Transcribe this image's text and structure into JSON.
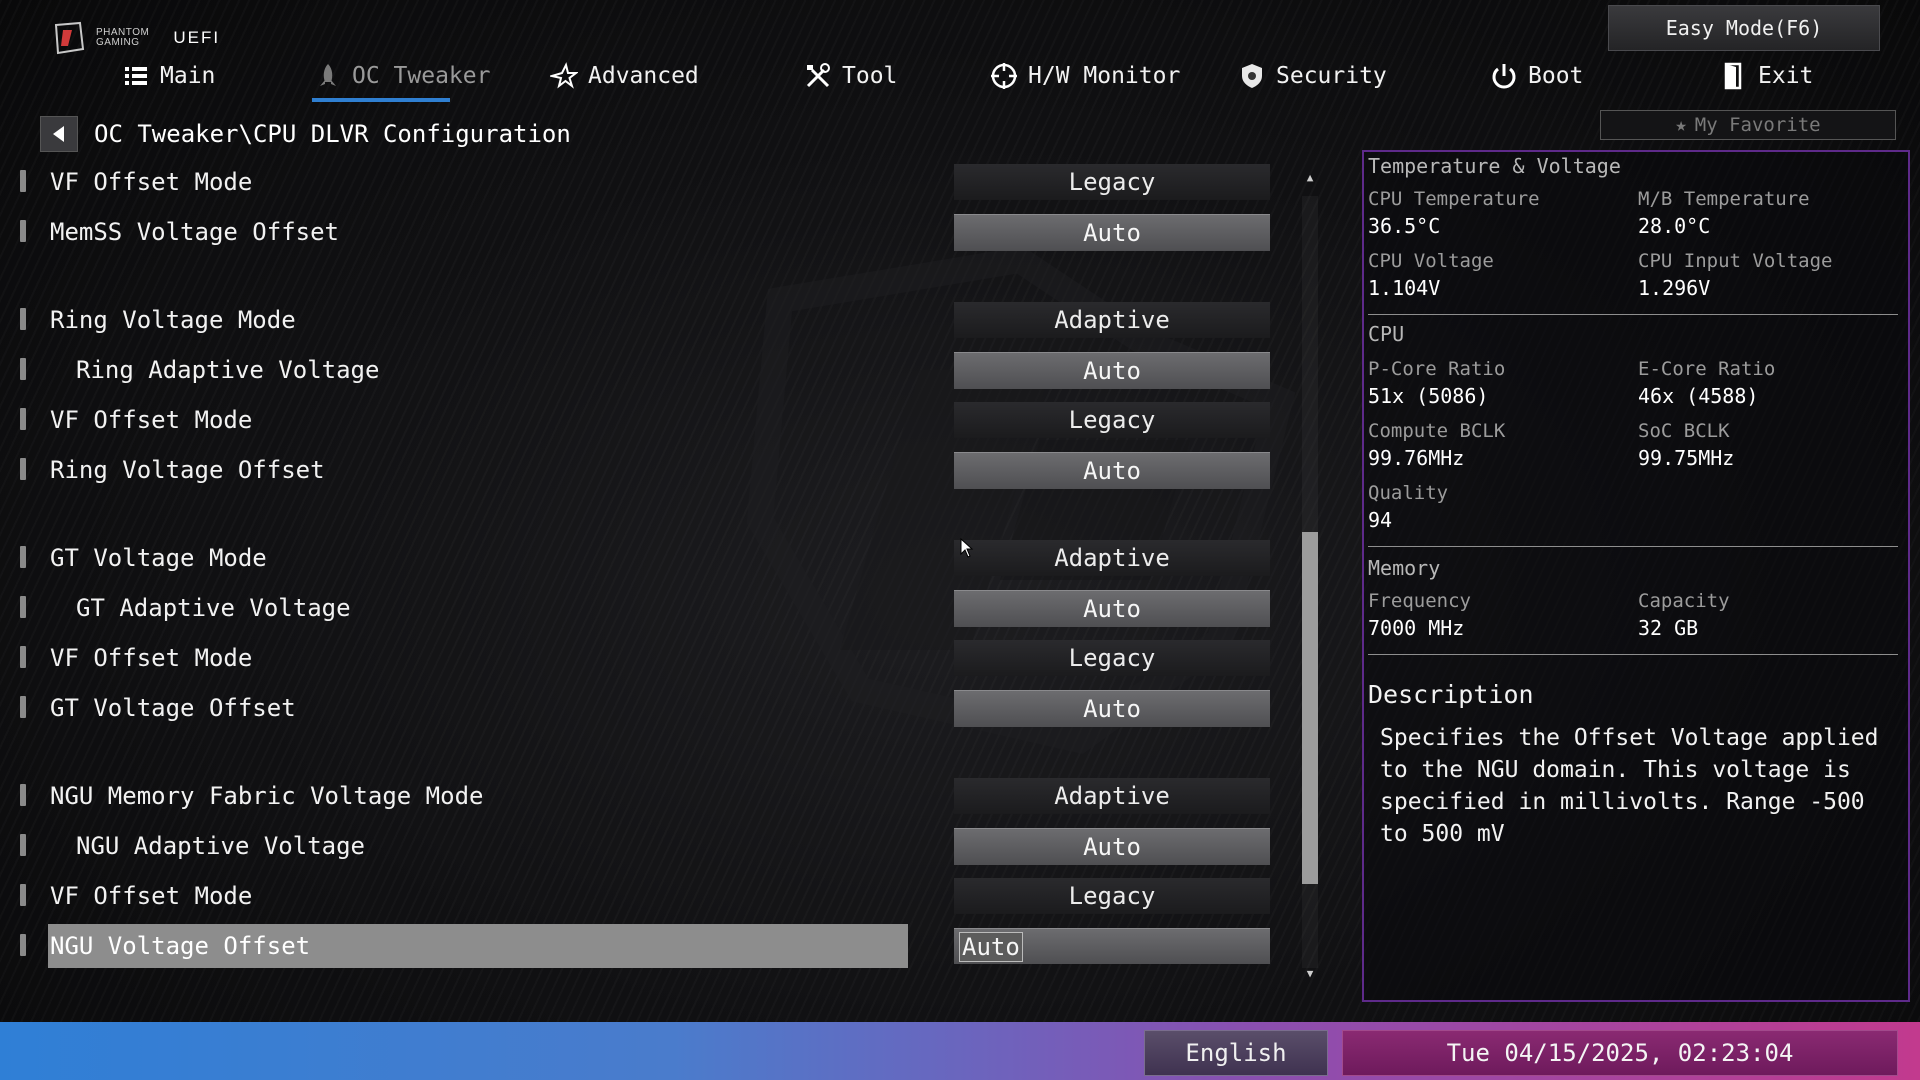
{
  "brand": {
    "logo_line1": "PHANTOM",
    "logo_line2": "GAMING",
    "uefi": "UEFI"
  },
  "easy_mode": "Easy Mode(F6)",
  "nav": [
    {
      "label": "Main",
      "icon": "list-icon"
    },
    {
      "label": "OC Tweaker",
      "icon": "rocket-icon",
      "active": true
    },
    {
      "label": "Advanced",
      "icon": "star-icon"
    },
    {
      "label": "Tool",
      "icon": "tools-icon"
    },
    {
      "label": "H/W Monitor",
      "icon": "crosshair-icon"
    },
    {
      "label": "Security",
      "icon": "shield-icon"
    },
    {
      "label": "Boot",
      "icon": "power-icon"
    },
    {
      "label": "Exit",
      "icon": "exit-door-icon"
    }
  ],
  "my_favorite": "My Favorite",
  "breadcrumb": "OC Tweaker\\CPU DLVR Configuration",
  "settings": [
    {
      "label": "VF Offset Mode",
      "value": "Legacy",
      "kind": "drop",
      "indent": false
    },
    {
      "label": "MemSS Voltage Offset",
      "value": "Auto",
      "kind": "field",
      "indent": false
    },
    {
      "label": "Ring Voltage Mode",
      "value": "Adaptive",
      "kind": "drop",
      "indent": false
    },
    {
      "label": "Ring Adaptive Voltage",
      "value": "Auto",
      "kind": "field",
      "indent": true
    },
    {
      "label": "VF Offset Mode",
      "value": "Legacy",
      "kind": "drop",
      "indent": false
    },
    {
      "label": "Ring Voltage Offset",
      "value": "Auto",
      "kind": "field",
      "indent": false
    },
    {
      "label": "GT Voltage Mode",
      "value": "Adaptive",
      "kind": "drop",
      "indent": false
    },
    {
      "label": "GT Adaptive Voltage",
      "value": "Auto",
      "kind": "field",
      "indent": true
    },
    {
      "label": "VF Offset Mode",
      "value": "Legacy",
      "kind": "drop",
      "indent": false
    },
    {
      "label": "GT Voltage Offset",
      "value": "Auto",
      "kind": "field",
      "indent": false
    },
    {
      "label": "NGU Memory Fabric Voltage Mode",
      "value": "Adaptive",
      "kind": "drop",
      "indent": false
    },
    {
      "label": "NGU Adaptive Voltage",
      "value": "Auto",
      "kind": "field",
      "indent": true
    },
    {
      "label": "VF Offset Mode",
      "value": "Legacy",
      "kind": "drop",
      "indent": false
    },
    {
      "label": "NGU Voltage Offset",
      "value": "Auto",
      "kind": "field",
      "indent": false,
      "selected": true
    }
  ],
  "scrollbar": {
    "position_fraction": 0.57,
    "visible_fraction": 0.46
  },
  "monitor": {
    "title": "Temperature & Voltage",
    "cpu_temp_label": "CPU Temperature",
    "cpu_temp": "36.5°C",
    "mb_temp_label": "M/B Temperature",
    "mb_temp": "28.0°C",
    "cpu_volt_label": "CPU Voltage",
    "cpu_volt": "1.104V",
    "cpu_in_volt_label": "CPU Input Voltage",
    "cpu_in_volt": "1.296V",
    "cpu_section": "CPU",
    "pcore_label": "P-Core Ratio",
    "pcore": "51x (5086)",
    "ecore_label": "E-Core Ratio",
    "ecore": "46x (4588)",
    "bclk_label": "Compute BCLK",
    "bclk": "99.76MHz",
    "soc_label": "SoC BCLK",
    "soc": "99.75MHz",
    "quality_label": "Quality",
    "quality": "94",
    "mem_section": "Memory",
    "freq_label": "Frequency",
    "freq": "7000 MHz",
    "cap_label": "Capacity",
    "cap": "32 GB"
  },
  "description": {
    "title": "Description",
    "text": "Specifies the Offset Voltage applied to the NGU domain. This voltage is specified in millivolts. Range -500 to 500 mV"
  },
  "footer": {
    "language": "English",
    "datetime": "Tue 04/15/2025, 02:23:04"
  },
  "colors": {
    "accent_blue": "#2f7fd1",
    "panel_border": "#5e2a8a",
    "bar_start": "#2f7fd6",
    "bar_end": "#c23a8e"
  }
}
